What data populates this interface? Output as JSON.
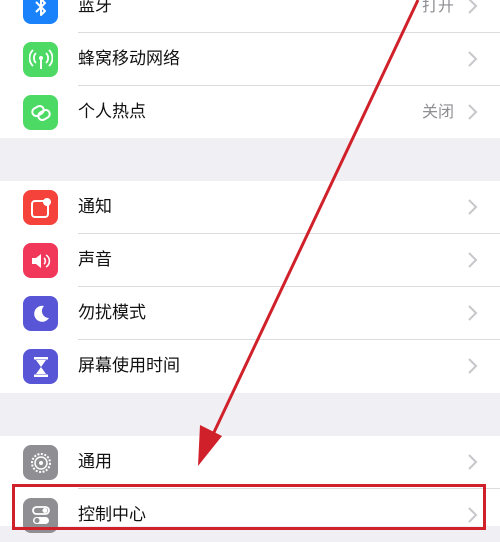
{
  "groups": [
    {
      "rows": [
        {
          "label": "蓝牙",
          "value": "打开",
          "icon": "bluetooth-icon",
          "color": "#1a82fb"
        },
        {
          "label": "蜂窝移动网络",
          "value": "",
          "icon": "cellular-antenna-icon",
          "color": "#4cd964"
        },
        {
          "label": "个人热点",
          "value": "关闭",
          "icon": "hotspot-chain-icon",
          "color": "#4cd964"
        }
      ]
    },
    {
      "rows": [
        {
          "label": "通知",
          "value": "",
          "icon": "notifications-icon",
          "color": "#f5423b"
        },
        {
          "label": "声音",
          "value": "",
          "icon": "speaker-icon",
          "color": "#f2385a"
        },
        {
          "label": "勿扰模式",
          "value": "",
          "icon": "moon-icon",
          "color": "#5856d6"
        },
        {
          "label": "屏幕使用时间",
          "value": "",
          "icon": "hourglass-icon",
          "color": "#5856d6"
        }
      ]
    },
    {
      "rows": [
        {
          "label": "通用",
          "value": "",
          "icon": "gear-icon",
          "color": "#8e8e93"
        },
        {
          "label": "控制中心",
          "value": "",
          "icon": "toggle-switches-icon",
          "color": "#8e8e93"
        }
      ]
    }
  ],
  "annotation": {
    "arrow_color": "#d0202a",
    "box_color": "#d0202a"
  }
}
